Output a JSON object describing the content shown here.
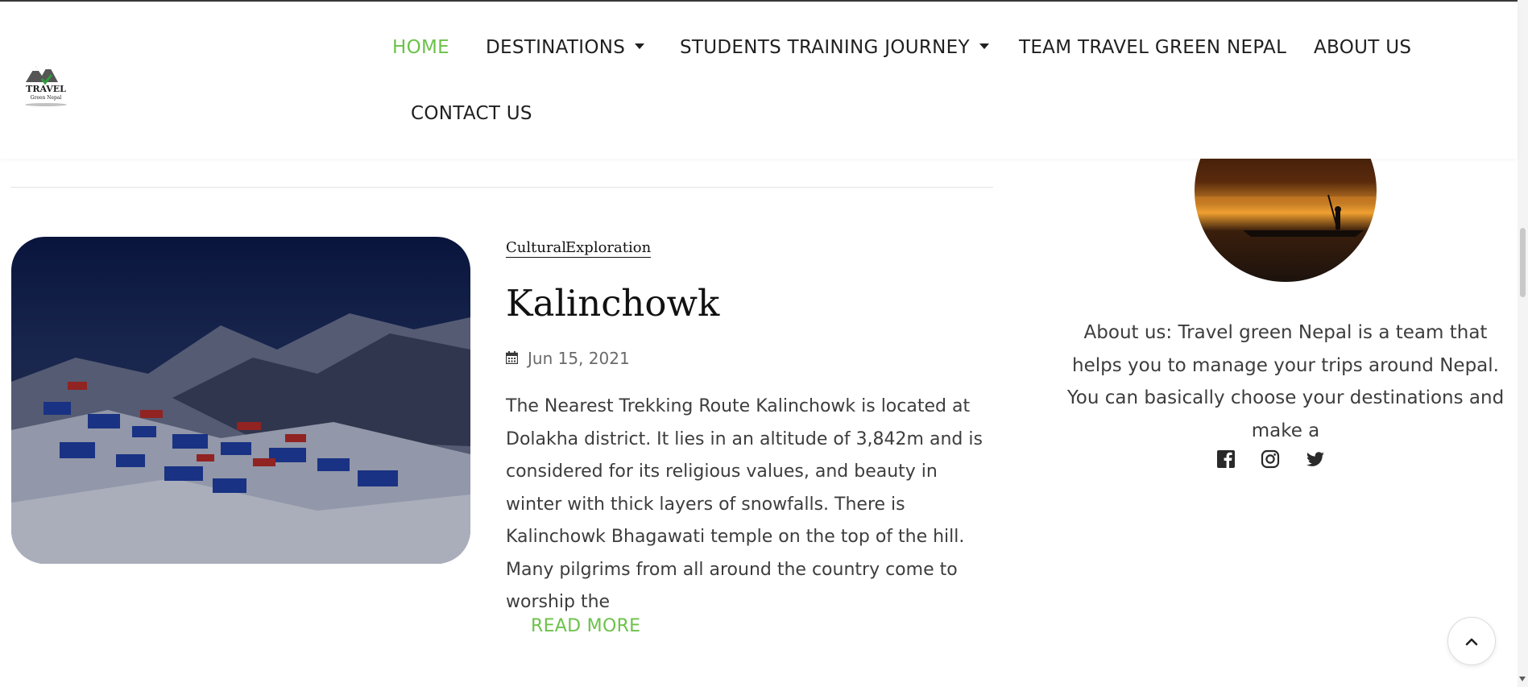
{
  "nav": {
    "items": [
      {
        "label": "HOME",
        "active": true
      },
      {
        "label": "DESTINATIONS",
        "dropdown": true
      },
      {
        "label": "STUDENTS TRAINING JOURNEY",
        "dropdown": true
      },
      {
        "label": "TEAM TRAVEL GREEN NEPAL"
      },
      {
        "label": "ABOUT US"
      },
      {
        "label": "CONTACT US"
      }
    ],
    "active_color": "#6cc24a"
  },
  "logo": {
    "text_top": "TRAVEL",
    "text_bottom": "Green Nepal"
  },
  "post": {
    "categories": [
      "Cultural",
      "Exploration"
    ],
    "title": "Kalinchowk",
    "date": "Jun 15, 2021",
    "excerpt": "The Nearest Trekking Route Kalinchowk is located at Dolakha district. It lies in an altitude of 3,842m and is considered for its religious values, and  beauty in winter with thick layers of snowfalls. There is Kalinchowk Bhagawati temple on the top of the hill. Many pilgrims from all around the country come to worship the",
    "read_more": "READ MORE"
  },
  "sidebar": {
    "about": "About us: Travel green Nepal is a team that helps you to manage your trips around Nepal. You can basically choose your destinations and make a",
    "social_icons": [
      "facebook-icon",
      "instagram-icon",
      "twitter-icon"
    ]
  },
  "accent": "#6cc24a"
}
